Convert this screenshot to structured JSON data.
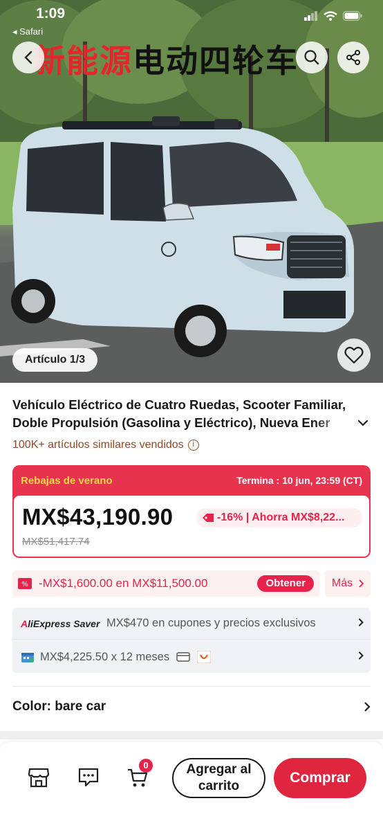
{
  "status_bar": {
    "time": "1:09",
    "back_app": "◂ Safari"
  },
  "hero": {
    "banner_red_1": "新能源",
    "banner_black": "电动四轮车",
    "article_counter": "Artículo 1/3"
  },
  "product": {
    "title_line1": "Vehículo Eléctrico de Cuatro Ruedas, Scooter Familiar,",
    "title_line2": "Doble Propulsión (Gasolina y Eléctrico), Nueva Ener",
    "sold": "100K+ artículos similares vendidos",
    "info_glyph": "i"
  },
  "sale": {
    "title": "Rebajas de verano",
    "deadline": "Termina : 10 jun, 23:59 (CT)",
    "price": "MX$43,190.90",
    "old_price": "MX$51,417.74",
    "discount": "-16% | Ahorra MX$8,22..."
  },
  "coupon": {
    "text": "-MX$1,600.00 en MX$11,500.00",
    "button": "Obtener",
    "more": "Más"
  },
  "saver": {
    "logo_a": "A",
    "logo_rest": "liExpress Saver",
    "text": "MX$470 en cupones y precios exclusivos",
    "installments": "MX$4,225.50 x 12 meses"
  },
  "color": {
    "label": "Color: bare car"
  },
  "bottom_bar": {
    "cart_count": "0",
    "add_to_cart": "Agregar al carrito",
    "buy": "Comprar"
  },
  "colors": {
    "accent": "#e7234b",
    "sale_header": "#e8334f",
    "promo_yellow": "#ffd84a",
    "sold_brown": "#8a4b25"
  }
}
